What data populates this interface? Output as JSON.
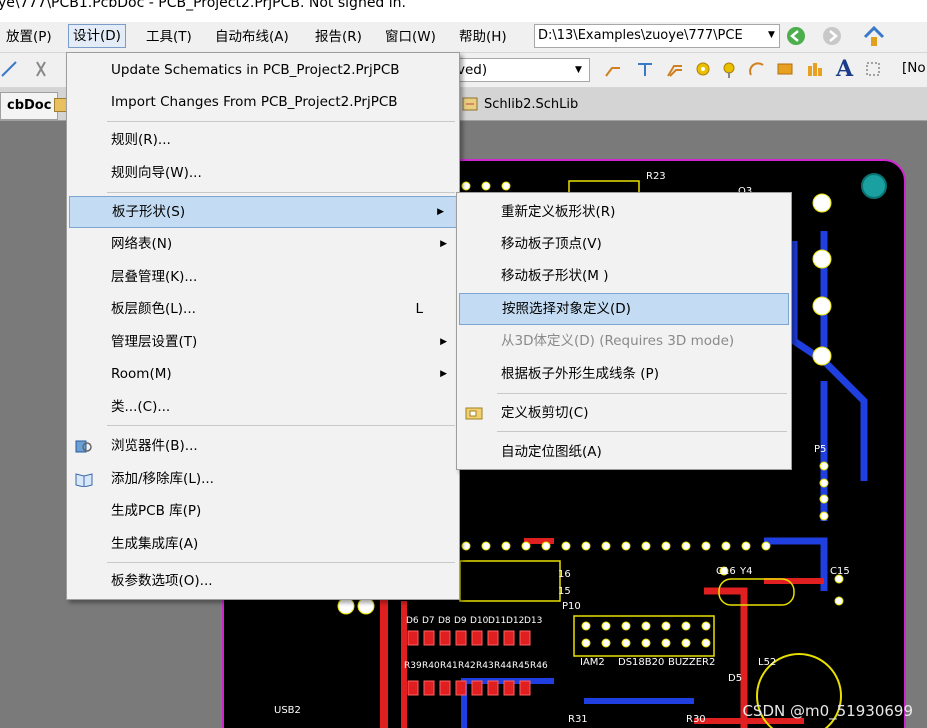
{
  "window": {
    "title": "ye\\777\\PCB1.PcbDoc - PCB_Project2.PrjPCB. Not signed in."
  },
  "menubar": {
    "items": [
      "放置(P)",
      "设计(D)",
      "工具(T)",
      "自动布线(A)",
      "报告(R)",
      "窗口(W)",
      "帮助(H)"
    ],
    "path": "D:\\13\\Examples\\zuoye\\777\\PCE"
  },
  "toolbar": {
    "combo_value": "ved)",
    "right_text": "[No"
  },
  "tabs": {
    "left": "cbDoc",
    "right": "Schlib2.SchLib"
  },
  "design_menu": {
    "items": [
      {
        "label": "Update Schematics in PCB_Project2.PrjPCB"
      },
      {
        "label": "Import Changes From PCB_Project2.PrjPCB"
      },
      {
        "label": "规则(R)..."
      },
      {
        "label": "规则向导(W)..."
      },
      {
        "label": "板子形状(S)"
      },
      {
        "label": "网络表(N)"
      },
      {
        "label": "层叠管理(K)..."
      },
      {
        "label": "板层颜色(L)...",
        "shortcut": "L"
      },
      {
        "label": "管理层设置(T)"
      },
      {
        "label": "Room(M)"
      },
      {
        "label": "类...(C)..."
      },
      {
        "label": "浏览器件(B)..."
      },
      {
        "label": "添加/移除库(L)..."
      },
      {
        "label": "生成PCB 库(P)"
      },
      {
        "label": "生成集成库(A)"
      },
      {
        "label": "板参数选项(O)..."
      }
    ]
  },
  "board_shape_submenu": {
    "items": [
      {
        "label": "重新定义板形状(R)"
      },
      {
        "label": "移动板子顶点(V)"
      },
      {
        "label": "移动板子形状(M )"
      },
      {
        "label": "按照选择对象定义(D)"
      },
      {
        "label": "从3D体定义(D) (Requires 3D mode)"
      },
      {
        "label": "根据板子外形生成线条 (P)"
      },
      {
        "label": "定义板剪切(C)"
      },
      {
        "label": "自动定位图纸(A)"
      }
    ]
  },
  "pcb_labels": [
    "R23",
    "P5",
    "C16",
    "Y4",
    "C15",
    "P10",
    "D6",
    "D7",
    "D8",
    "D9",
    "D10",
    "D11",
    "D12",
    "D13",
    "R39",
    "R40",
    "R41",
    "R42",
    "R43",
    "R44",
    "R45",
    "R46",
    "IAM2",
    "DS18B20",
    "BUZZER2",
    "D5",
    "L52",
    "USB2",
    "R31",
    "R30",
    "Q3",
    "16",
    "15"
  ],
  "watermark": "CSDN @m0_51930699",
  "colors": {
    "board_outline": "#d026d0",
    "track_blue": "#1f3fe0",
    "track_red": "#e02020",
    "pad_yellow": "#e8e000",
    "highlight": "#c3dcf3"
  }
}
